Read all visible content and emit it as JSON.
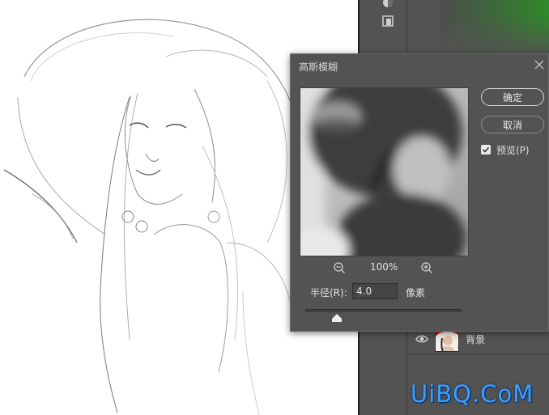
{
  "dialog": {
    "title": "高斯模糊",
    "ok_label": "确定",
    "cancel_label": "取消",
    "preview_checkbox_label": "预览(P)",
    "preview_checked": true,
    "zoom_level": "100%",
    "radius_label": "半径(R):",
    "radius_value": "4.0",
    "radius_unit": "像素",
    "radius_slider_fraction": 0.2
  },
  "layers": {
    "items": [
      {
        "name": "背景",
        "visible": true
      }
    ]
  },
  "watermark": {
    "text": "UiBQ.CoM"
  },
  "icons": {
    "close": "close-icon",
    "zoom_out": "zoom-out-icon",
    "zoom_in": "zoom-in-icon",
    "eye": "eye-icon",
    "checkmark": "checkmark-icon",
    "slider_thumb": "triangle-up-icon"
  },
  "colors": {
    "panel_bg": "#535353",
    "canvas_bg": "#ffffff",
    "accent_green": "#2f8a2b",
    "watermark_blue": "#3aa0ff"
  }
}
